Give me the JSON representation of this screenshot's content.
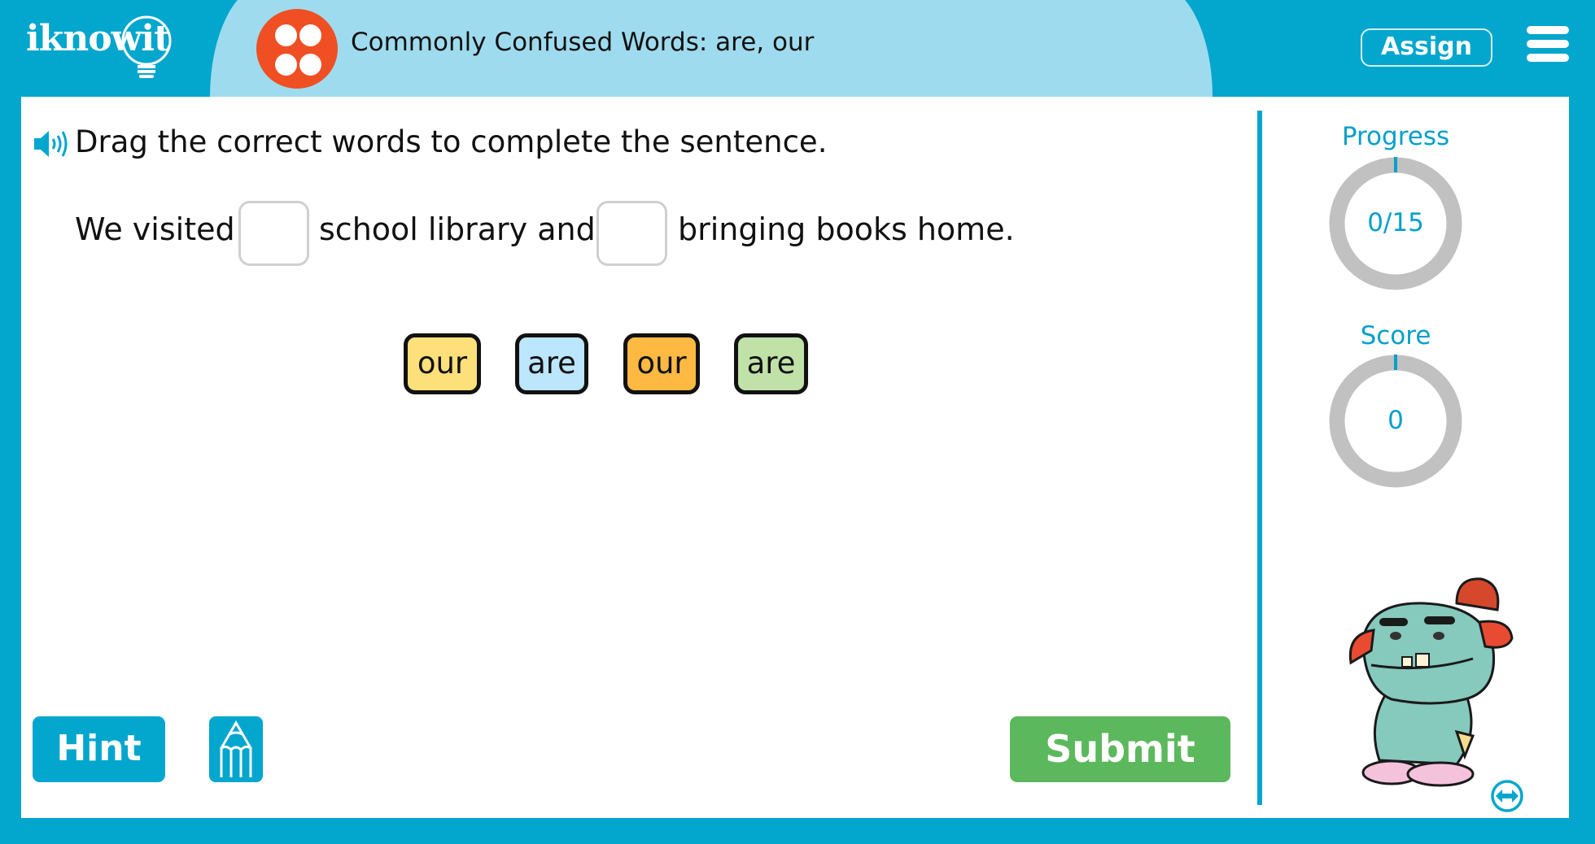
{
  "header": {
    "logo_text": "iknowit",
    "lesson_title": "Commonly Confused Words: are, our",
    "assign_label": "Assign",
    "menu_icon": "hamburger-menu-icon",
    "lesson_icon": "four-dots-icon",
    "colors": {
      "bar": "#03a6cd",
      "tab": "#9fdbee",
      "lesson_icon": "#ef4f23"
    }
  },
  "question": {
    "instruction": "Drag the correct words to complete the sentence.",
    "audio_icon": "speaker-icon",
    "sentence_parts": [
      "We visited",
      "school library and",
      "bringing books home."
    ],
    "blanks": [
      "",
      ""
    ]
  },
  "word_tiles": [
    {
      "label": "our",
      "color": "#fee07a"
    },
    {
      "label": "are",
      "color": "#bbe6fb"
    },
    {
      "label": "our",
      "color": "#fdb942"
    },
    {
      "label": "are",
      "color": "#c0e1a8"
    }
  ],
  "buttons": {
    "hint": "Hint",
    "submit": "Submit",
    "scratchpad_icon": "pencil-icon",
    "expand_icon": "expand-arrows-icon"
  },
  "sidebar": {
    "progress": {
      "label": "Progress",
      "value_text": "0/15",
      "completed": 0,
      "total": 15
    },
    "score": {
      "label": "Score",
      "value_text": "0",
      "value": 0
    },
    "colors": {
      "accent": "#05a0ca",
      "ring": "#c1c1c1"
    }
  }
}
